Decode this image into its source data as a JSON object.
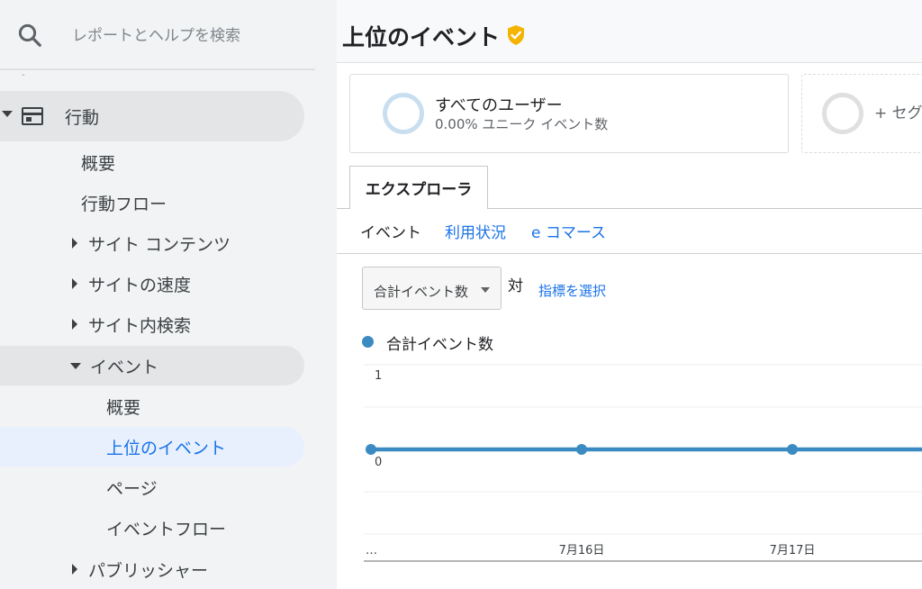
{
  "sidebar": {
    "search_placeholder": "レポートとヘルプを検索",
    "section_label": "行動",
    "items": {
      "overview": "概要",
      "behavior_flow": "行動フロー",
      "site_content": "サイト コンテンツ",
      "site_speed": "サイトの速度",
      "site_search": "サイト内検索",
      "events": "イベント",
      "events_overview": "概要",
      "top_events": "上位のイベント",
      "pages": "ページ",
      "event_flow": "イベントフロー",
      "publisher": "パブリッシャー"
    }
  },
  "main": {
    "title": "上位のイベント",
    "segment": {
      "name": "すべてのユーザー",
      "sub": "0.00% ユニーク イベント数",
      "add": "+ セグ"
    },
    "explorer_tab": "エクスプローラ",
    "subtabs": [
      "イベント",
      "利用状況",
      "e コマース"
    ],
    "metric_select": "合計イベント数",
    "vs": "対",
    "pick_metric": "指標を選択",
    "legend": "合計イベント数"
  },
  "colors": {
    "accent": "#1a73e8",
    "series": "#3b8bc2",
    "verified": "#f4b400"
  },
  "chart_data": {
    "type": "line",
    "x": [
      "…",
      "7月16日",
      "7月17日",
      ""
    ],
    "series": [
      {
        "values": [
          0,
          0,
          0,
          0
        ]
      }
    ],
    "yticks": [
      "1",
      "0"
    ],
    "ylim": [
      -1,
      1
    ]
  }
}
